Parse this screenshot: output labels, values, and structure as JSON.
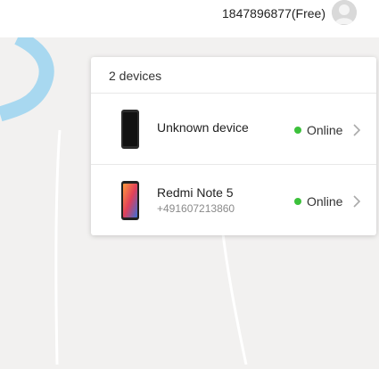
{
  "header": {
    "account_label": "1847896877(Free)",
    "avatar_icon": "user-avatar-icon"
  },
  "panel": {
    "title": "2 devices",
    "devices": [
      {
        "name": "Unknown device",
        "subtitle": "",
        "status": "Online",
        "icon": "phone-icon"
      },
      {
        "name": "Redmi Note 5",
        "subtitle": "+491607213860",
        "status": "Online",
        "icon": "phone-icon"
      }
    ]
  },
  "colors": {
    "online": "#3cc13b",
    "river": "#a8d8f0",
    "map_bg": "#f2f1f0"
  }
}
